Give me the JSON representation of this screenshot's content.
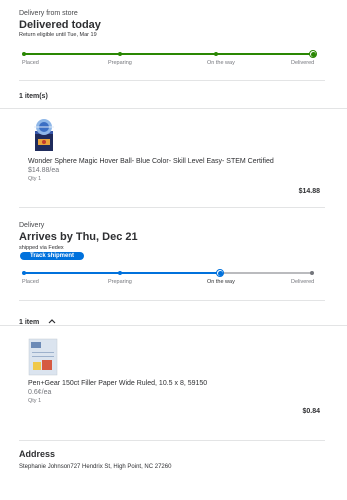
{
  "store_delivery": {
    "label": "Delivery from store",
    "status": "Delivered today",
    "return_note": "Return eligible until Tue, Mar 19",
    "stages": [
      "Placed",
      "Preparing",
      "On the way",
      "Delivered"
    ],
    "progress_color": "#2a8703",
    "progress_stage_index": 3
  },
  "store_items": {
    "header": "1 item(s)",
    "items": [
      {
        "name": "Wonder Sphere Magic Hover Ball- Blue Color- Skill Level Easy- STEM Certified",
        "unit_price": "$14.88/ea",
        "qty": "Qty 1",
        "total": "$14.88",
        "image_icon": "hover-ball-product-image"
      }
    ]
  },
  "shipping": {
    "label": "Delivery",
    "status": "Arrives by Thu, Dec 21",
    "carrier": "shipped via Fedex",
    "track_button": "Track shipment",
    "stages": [
      "Placed",
      "Preparing",
      "On the way",
      "Delivered"
    ],
    "progress_color": "#0071dc",
    "progress_stage_index": 2
  },
  "shipping_items": {
    "header": "1 item",
    "toggle_icon": "chevron-up-icon",
    "items": [
      {
        "name": "Pen+Gear 150ct Filler Paper Wide Ruled, 10.5 x 8, 59150",
        "unit_price": "0.6¢/ea",
        "qty": "Qty 1",
        "total": "$0.84",
        "image_icon": "filler-paper-product-image"
      }
    ]
  },
  "address": {
    "title": "Address",
    "line": "Stephanie Johnson727 Hendrix St, High Point, NC 27260"
  }
}
